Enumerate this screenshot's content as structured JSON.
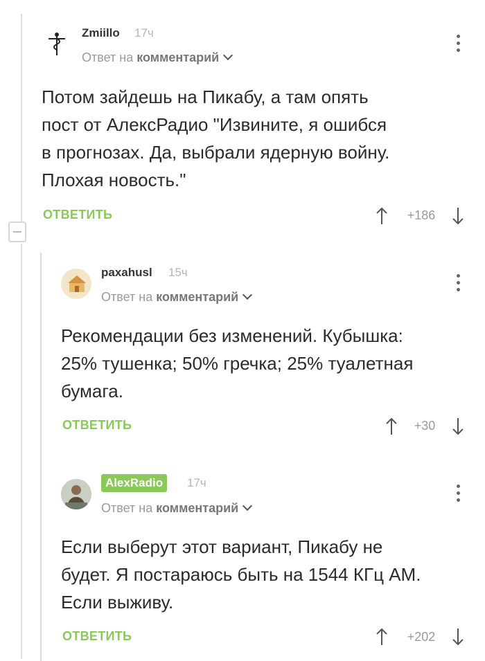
{
  "comments": [
    {
      "author": "Zmiillo",
      "time": "17ч",
      "reply_prefix": "Ответ на",
      "reply_target": "комментарий",
      "lines": [
        "Потом зайдешь на Пикабу, а там опять",
        "пост от АлексРадио \"Извините, я ошибся",
        "в прогнозах. Да, выбрали ядерную войну.",
        "Плохая новость.\""
      ],
      "reply_label": "ОТВЕТИТЬ",
      "score": "+186"
    },
    {
      "author": "paxahusl",
      "time": "15ч",
      "reply_prefix": "Ответ на",
      "reply_target": "комментарий",
      "lines": [
        "Рекомендации без изменений. Кубышка:",
        "25% тушенка; 50% гречка; 25% туалетная",
        "бумага."
      ],
      "reply_label": "ОТВЕТИТЬ",
      "score": "+30"
    },
    {
      "author": "AlexRadio",
      "time": "17ч",
      "reply_prefix": "Ответ на",
      "reply_target": "комментарий",
      "lines": [
        "Если выберут этот вариант, Пикабу не",
        "будет. Я постараюсь быть на 1544 КГц АМ.",
        "Если выживу."
      ],
      "reply_label": "ОТВЕТИТЬ",
      "score": "+202"
    }
  ],
  "colors": {
    "accent": "#8ac858",
    "muted": "#9a9a9a",
    "text": "#2b2b2b"
  },
  "icons": {
    "menu": "vertical-dots-icon",
    "up": "arrow-up-icon",
    "down": "arrow-down-icon",
    "collapse": "minus-icon"
  }
}
